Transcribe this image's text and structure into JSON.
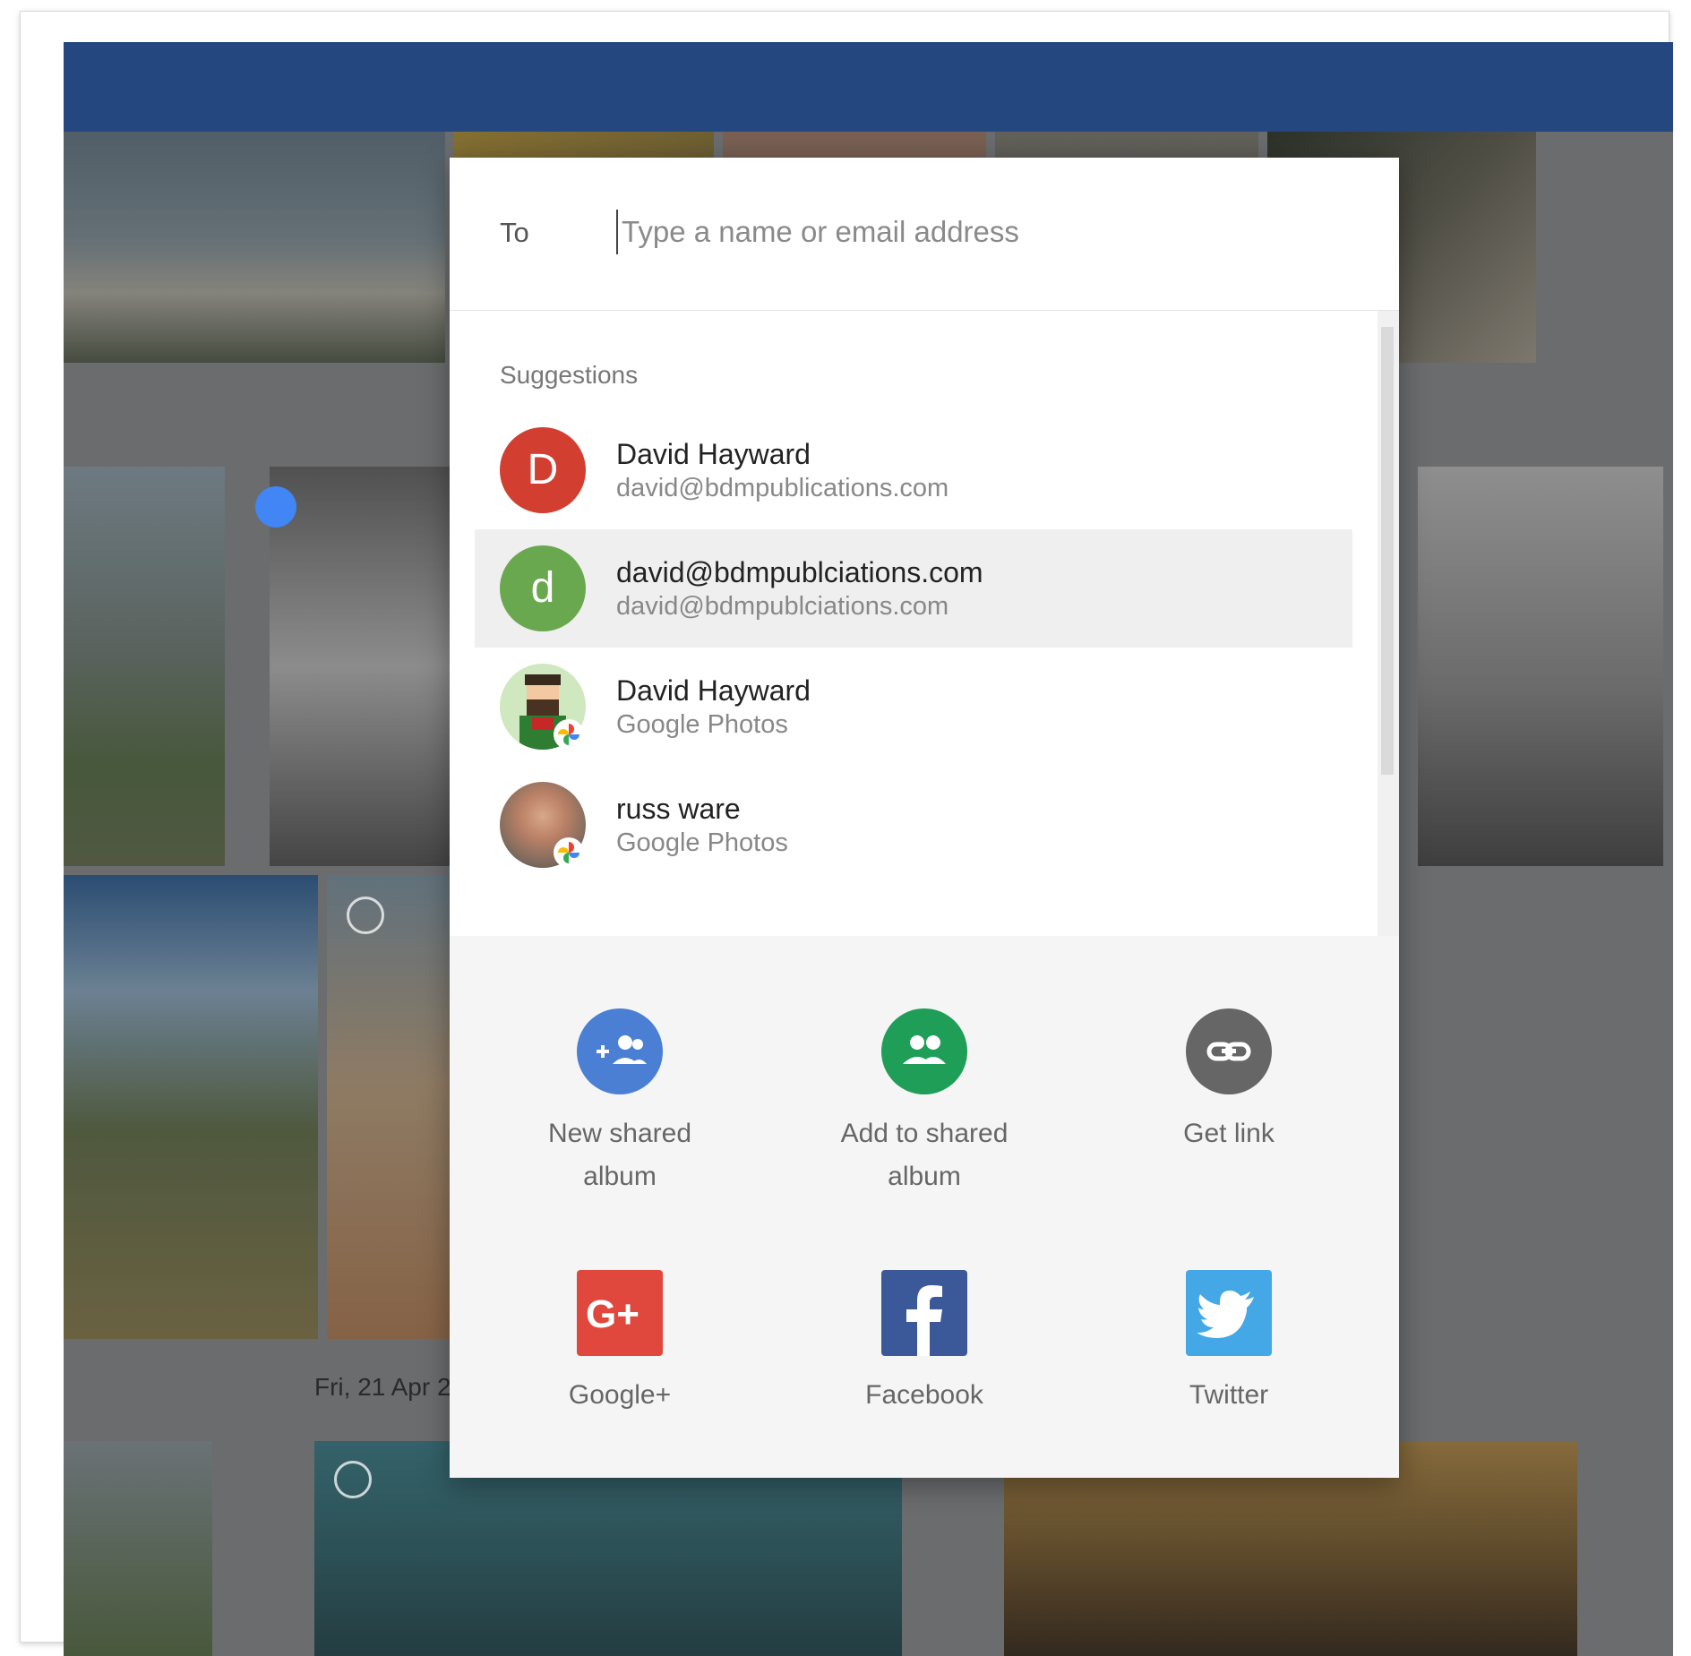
{
  "share_dialog": {
    "to_label": "To",
    "to_placeholder": "Type a name or email address",
    "suggestions_title": "Suggestions",
    "contacts": [
      {
        "initial": "D",
        "name": "David Hayward",
        "sub": "david@bdmpublications.com",
        "avatar_color": "#d23f31"
      },
      {
        "initial": "d",
        "name": "david@bdmpublciations.com",
        "sub": "david@bdmpublciations.com",
        "avatar_color": "#6aa84f"
      },
      {
        "name": "David Hayward",
        "sub": "Google Photos"
      },
      {
        "name": "russ ware",
        "sub": "Google Photos"
      }
    ],
    "actions": [
      {
        "label_line1": "New shared",
        "label_line2": "album",
        "icon": "add-people-icon",
        "color": "#4a7fd4"
      },
      {
        "label_line1": "Add to shared",
        "label_line2": "album",
        "icon": "people-icon",
        "color": "#1e9e57"
      },
      {
        "label_line1": "Get link",
        "label_line2": "",
        "icon": "link-icon",
        "color": "#666666"
      }
    ],
    "social": [
      {
        "label": "Google+",
        "icon": "google-plus-icon",
        "color": "#e0483e"
      },
      {
        "label": "Facebook",
        "icon": "facebook-icon",
        "color": "#3b5998"
      },
      {
        "label": "Twitter",
        "icon": "twitter-icon",
        "color": "#45a8e6"
      }
    ]
  },
  "background": {
    "date_label": "Fri, 21 Apr 20"
  }
}
